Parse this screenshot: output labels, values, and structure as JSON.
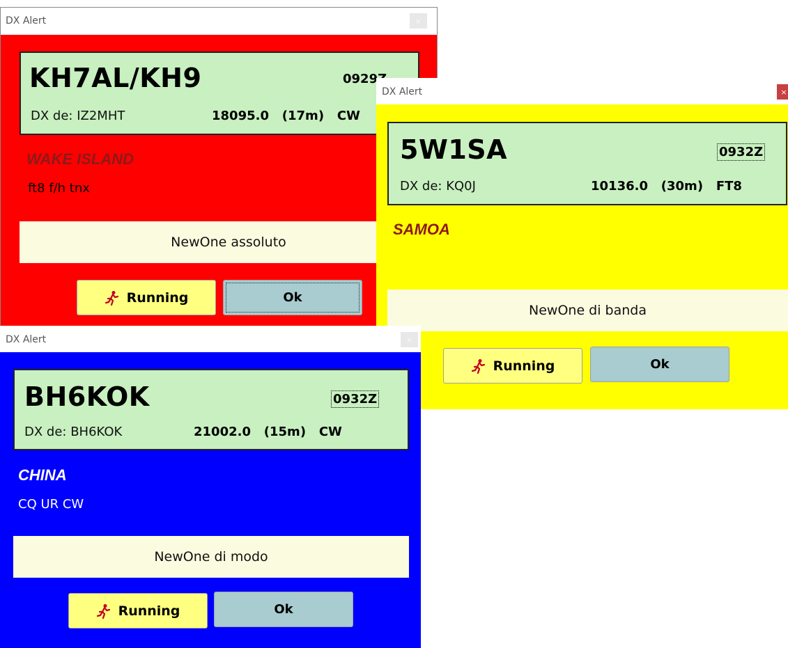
{
  "windows": [
    {
      "title": "DX Alert",
      "close_label": "×",
      "callsign": "KH7AL/KH9",
      "time": "0929Z",
      "spotter": "DX de: IZ2MHT",
      "frequency": "18095.0   (17m)   CW",
      "country": "WAKE ISLAND",
      "comment": "ft8 f/h tnx",
      "alert": "NewOne assoluto",
      "running_label": "Running",
      "ok_label": "Ok",
      "background_color": "#ff0000",
      "country_color": "#8b1a1a",
      "comment_color": "#000000"
    },
    {
      "title": "DX Alert",
      "close_label": "×",
      "callsign": "5W1SA",
      "time": "0932Z",
      "spotter": "DX de: KQ0J",
      "frequency": "10136.0   (30m)   FT8",
      "country": "SAMOA",
      "comment": "",
      "alert": "NewOne di banda",
      "running_label": "Running",
      "ok_label": "Ok",
      "background_color": "#ffff00",
      "country_color": "#8b1a1a",
      "comment_color": "#000000"
    },
    {
      "title": "DX Alert",
      "close_label": "×",
      "callsign": "BH6KOK",
      "time": "0932Z",
      "spotter": "DX de: BH6KOK",
      "frequency": "21002.0   (15m)   CW",
      "country": "CHINA",
      "comment": "CQ UR CW",
      "alert": "NewOne di modo",
      "running_label": "Running",
      "ok_label": "Ok",
      "background_color": "#0000ff",
      "country_color": "#ffffff",
      "comment_color": "#ffffff"
    }
  ],
  "icons": {
    "running": "running-man-icon",
    "close": "close-icon"
  }
}
